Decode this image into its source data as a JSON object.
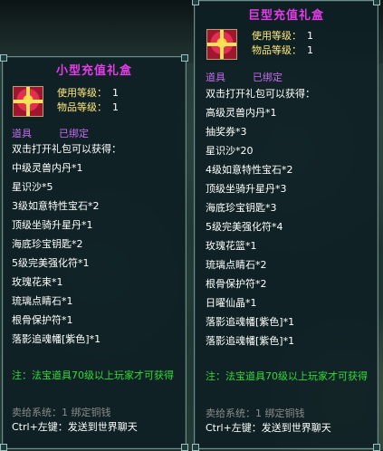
{
  "colors": {
    "title": "#e43ce8",
    "level_label": "#ffe87a",
    "type_label": "#c56cf0",
    "note": "#2fdc3a",
    "sale": "#8c8c8c",
    "body_text": "#ffffff"
  },
  "small_gift": {
    "title": "小型充值礼盒",
    "icon": "gift-box-icon",
    "use_level_label": "使用等级：",
    "use_level_value": "1",
    "item_level_label": "物品等级：",
    "item_level_value": "1",
    "type": "道具",
    "bound": "已绑定",
    "lines": [
      "双击打开礼包可以获得：",
      "中级灵兽内丹*1",
      "星识沙*5",
      "3级如意特性宝石*2",
      "顶级坐骑升星丹*1",
      "海底珍宝钥匙*2",
      "5级完美强化符*1",
      "玫瑰花束*1",
      "琉璃点睛石*1",
      "根骨保护符*1",
      "落影追魂幡[紫色]*1"
    ],
    "note": "注：法宝道具70级以上玩家才可获得",
    "sale": "卖给系统：1 绑定铜钱",
    "ctrl": "Ctrl+左键：发送到世界聊天"
  },
  "large_gift": {
    "title": "巨型充值礼盒",
    "icon": "gift-box-icon",
    "use_level_label": "使用等级：",
    "use_level_value": "1",
    "item_level_label": "物品等级：",
    "item_level_value": "1",
    "type": "道具",
    "bound": "已绑定",
    "lines": [
      "双击打开礼包可以获得：",
      "高级灵兽内丹*1",
      "抽奖券*3",
      "星识沙*20",
      "4级如意特性宝石*2",
      "顶级坐骑升星丹*3",
      "海底珍宝钥匙*3",
      "5级完美强化符*4",
      "玫瑰花篮*1",
      "琉璃点睛石*2",
      "根骨保护符*2",
      "日曜仙晶*1",
      "落影追魂幡[紫色]*1",
      "落影追魂幡[紫色]*1"
    ],
    "note": "注：法宝道具70级以上玩家才可获得",
    "sale": "卖给系统：1 绑定铜钱",
    "ctrl": "Ctrl+左键：发送到世界聊天"
  }
}
